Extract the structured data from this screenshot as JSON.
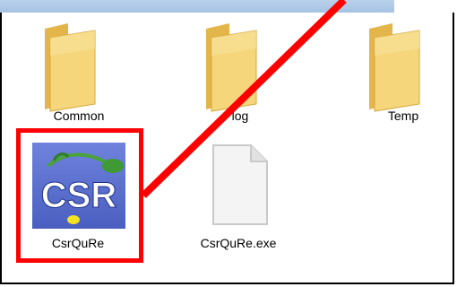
{
  "files": [
    {
      "name": "Common",
      "icon": "folder-icon"
    },
    {
      "name": "log",
      "icon": "folder-icon"
    },
    {
      "name": "Temp",
      "icon": "folder-icon"
    },
    {
      "name": "CsrQuRe",
      "icon": "csr-app-icon",
      "icon_text": "CSR"
    },
    {
      "name": "CsrQuRe.exe",
      "icon": "blank-file-icon"
    }
  ],
  "colors": {
    "highlight": "#ff0000",
    "folder": "#f2cf6b",
    "app_icon_bg": "#5a6fd0"
  }
}
